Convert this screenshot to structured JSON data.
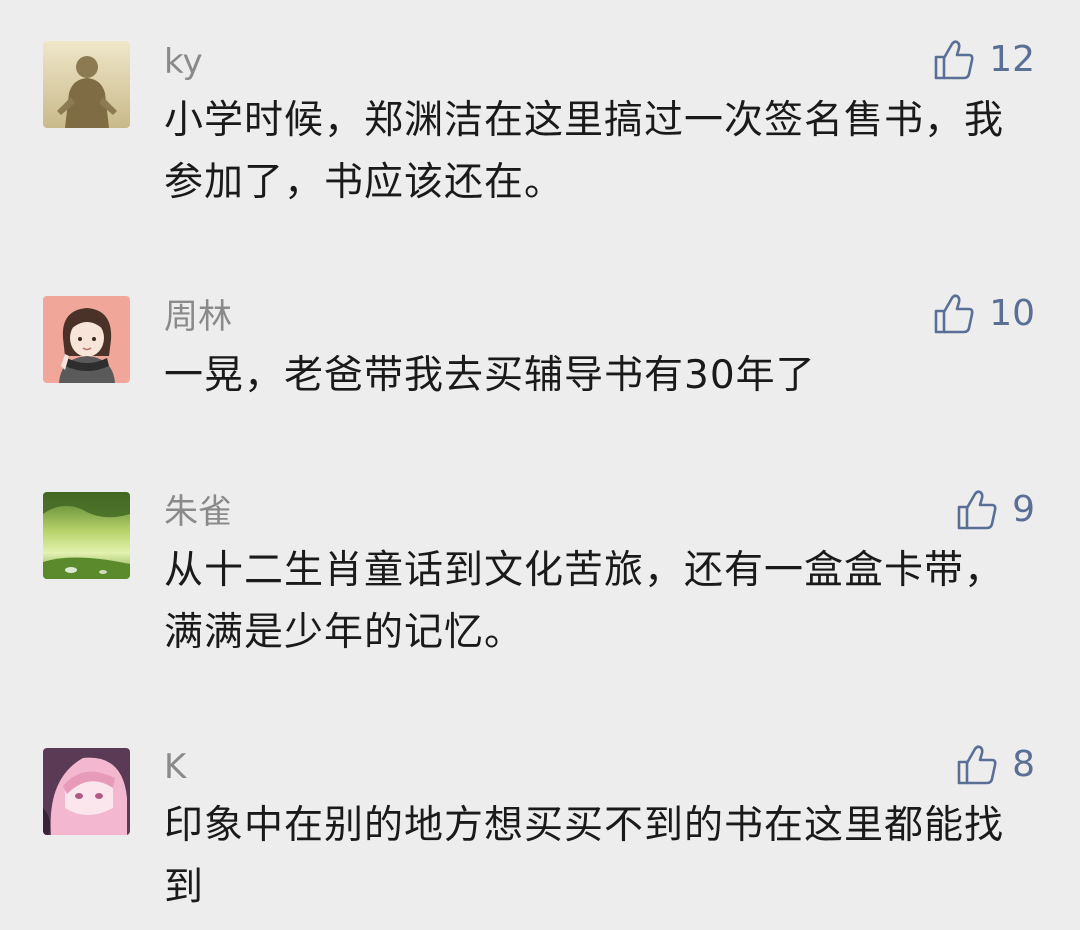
{
  "comments": [
    {
      "username": "ky",
      "likes": "12",
      "text": "小学时候，郑渊洁在这里搞过一次签名售书，我参加了，书应该还在。",
      "avatar_icon": "person-silhouette-avatar"
    },
    {
      "username": "周林",
      "likes": "10",
      "text": "一晃，老爸带我去买辅导书有30年了",
      "avatar_icon": "anime-girl-scarf-avatar"
    },
    {
      "username": "朱雀",
      "likes": "9",
      "text": "从十二生肖童话到文化苦旅，还有一盒盒卡带，满满是少年的记忆。",
      "avatar_icon": "green-landscape-avatar"
    },
    {
      "username": "K",
      "likes": "8",
      "text": "印象中在别的地方想买买不到的书在这里都能找到",
      "avatar_icon": "pink-anime-avatar"
    }
  ],
  "colors": {
    "background": "#ededed",
    "username": "#8a8a8a",
    "like": "#5a6f96",
    "text": "#1a1a1a"
  }
}
